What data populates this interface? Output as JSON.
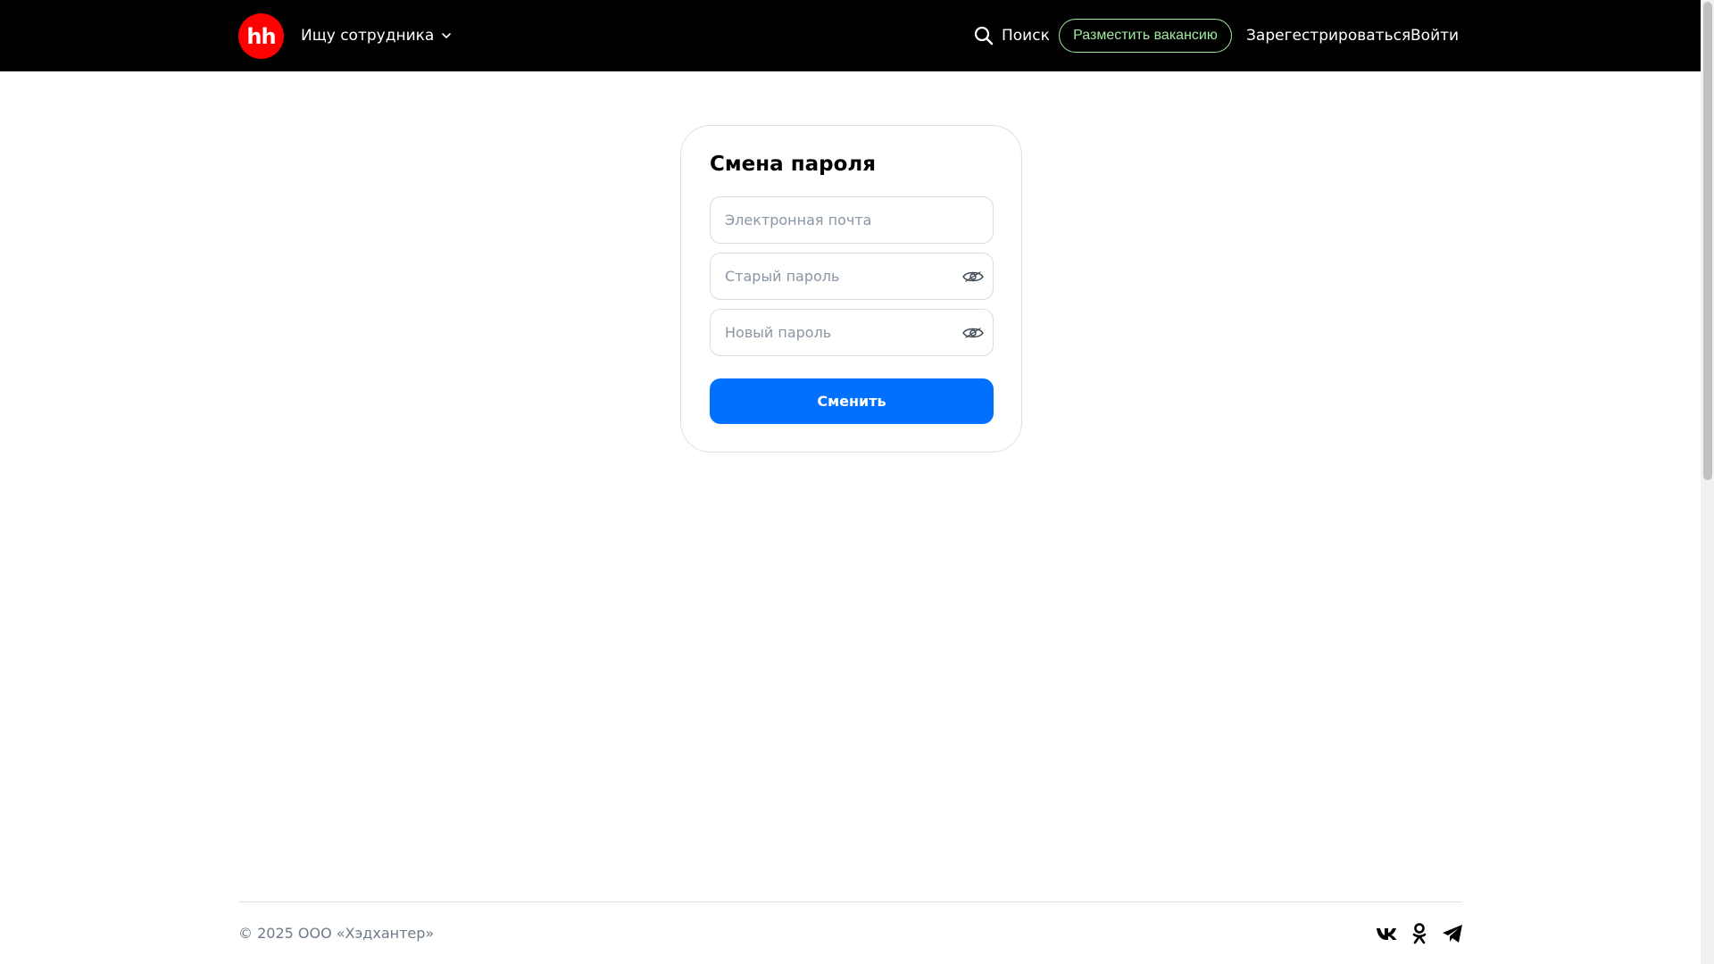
{
  "header": {
    "logo_text": "hh",
    "role_switch_label": "Ищу сотрудника",
    "search_label": "Поиск",
    "post_vacancy_label": "Разместить вакансию",
    "register_label": "Зарегестрироваться",
    "login_label": "Войти"
  },
  "form": {
    "title": "Смена пароля",
    "email": {
      "value": "",
      "placeholder": "Электронная почта"
    },
    "old_password": {
      "value": "",
      "placeholder": "Старый пароль"
    },
    "new_password": {
      "value": "",
      "placeholder": "Новый пароль"
    },
    "submit_label": "Сменить"
  },
  "footer": {
    "copyright": "© 2025 ООО «Хэдхантер»",
    "socials": [
      "vk-icon",
      "odnoklassniki-icon",
      "telegram-icon"
    ]
  },
  "colors": {
    "header_bg": "#000000",
    "logo_red": "#ff0000",
    "accent_blue": "#0070ff",
    "vacancy_green": "#a0e9a0",
    "muted_text": "#6e7a87"
  },
  "icons": {
    "search": "search-icon",
    "chevron": "chevron-down-icon",
    "password_visibility": "eye-icon"
  }
}
